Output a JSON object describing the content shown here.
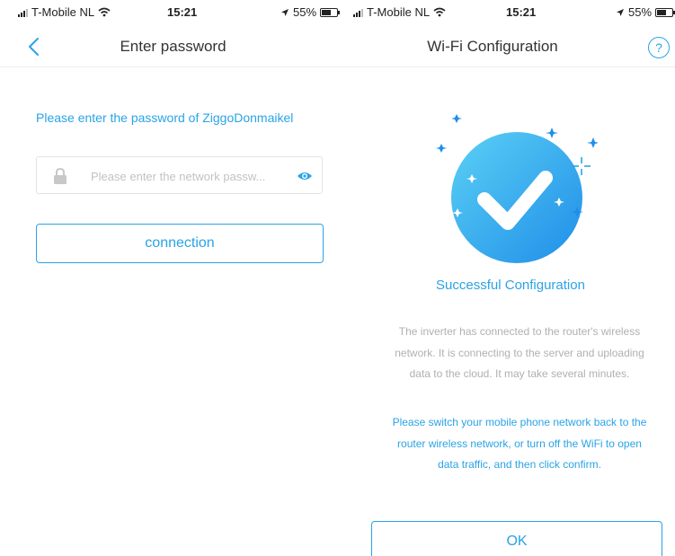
{
  "left_screen": {
    "status_bar": {
      "carrier": "T-Mobile NL",
      "time": "15:21",
      "battery": "55%"
    },
    "nav": {
      "title": "Enter password",
      "back_icon": "chevron-left-icon"
    },
    "prompt": "Please enter the password of ZiggoDonmaikel",
    "password_field": {
      "placeholder": "Please enter the network passw...",
      "value": "",
      "lock_icon": "lock-icon",
      "eye_icon": "eye-icon"
    },
    "connect_button": "connection"
  },
  "right_screen": {
    "status_bar": {
      "carrier": "T-Mobile NL",
      "time": "15:21",
      "battery": "55%"
    },
    "nav": {
      "title": "Wi-Fi Configuration",
      "help_symbol": "?"
    },
    "success_title": "Successful Configuration",
    "description": "The inverter has connected to the router's wireless network. It is connecting to the server and uploading data to the cloud. It may take several minutes.",
    "instruction": "Please switch your mobile phone network back to the router wireless network, or turn off the WiFi to open data traffic, and then click confirm.",
    "ok_button": "OK"
  },
  "colors": {
    "accent": "#2aa3e6",
    "muted_text": "#b0b0b0"
  }
}
